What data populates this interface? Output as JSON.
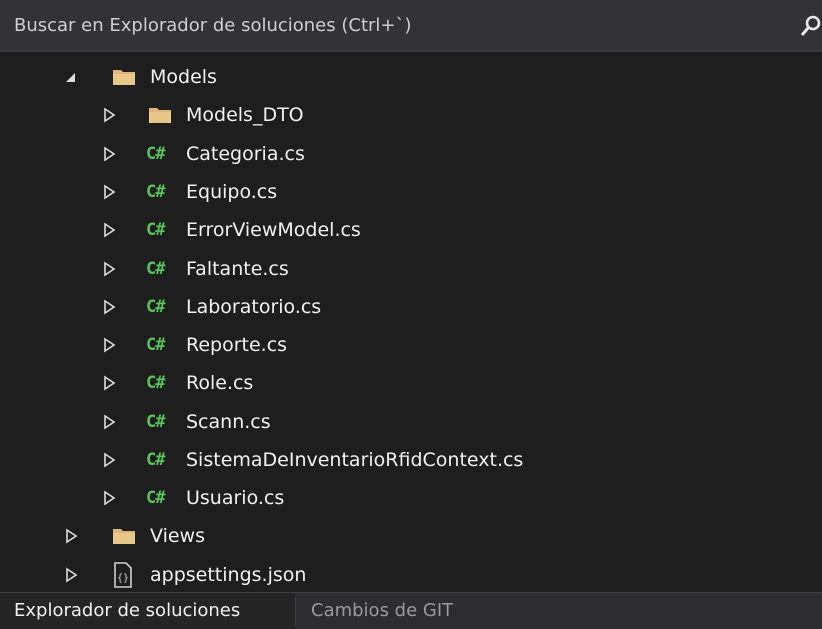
{
  "search": {
    "placeholder": "Buscar en Explorador de soluciones (Ctrl+`)"
  },
  "tree": {
    "items": [
      {
        "label": "Models",
        "type": "folder",
        "expanded": true
      },
      {
        "label": "Models_DTO",
        "type": "folder",
        "expanded": false
      },
      {
        "label": "Categoria.cs",
        "type": "csharp",
        "icon_text": "C#"
      },
      {
        "label": "Equipo.cs",
        "type": "csharp",
        "icon_text": "C#"
      },
      {
        "label": "ErrorViewModel.cs",
        "type": "csharp",
        "icon_text": "C#"
      },
      {
        "label": "Faltante.cs",
        "type": "csharp",
        "icon_text": "C#"
      },
      {
        "label": "Laboratorio.cs",
        "type": "csharp",
        "icon_text": "C#"
      },
      {
        "label": "Reporte.cs",
        "type": "csharp",
        "icon_text": "C#"
      },
      {
        "label": "Role.cs",
        "type": "csharp",
        "icon_text": "C#"
      },
      {
        "label": "Scann.cs",
        "type": "csharp",
        "icon_text": "C#"
      },
      {
        "label": "SistemaDeInventarioRfidContext.cs",
        "type": "csharp",
        "icon_text": "C#"
      },
      {
        "label": "Usuario.cs",
        "type": "csharp",
        "icon_text": "C#"
      },
      {
        "label": "Views",
        "type": "folder",
        "expanded": false
      },
      {
        "label": "appsettings.json",
        "type": "json",
        "expanded": false
      }
    ]
  },
  "tabs": [
    {
      "label": "Explorador de soluciones",
      "active": true
    },
    {
      "label": "Cambios de GIT",
      "active": false
    }
  ],
  "colors": {
    "background": "#1e1e1e",
    "csharp_icon": "#58c35a",
    "folder_icon": "#dcb67a"
  }
}
